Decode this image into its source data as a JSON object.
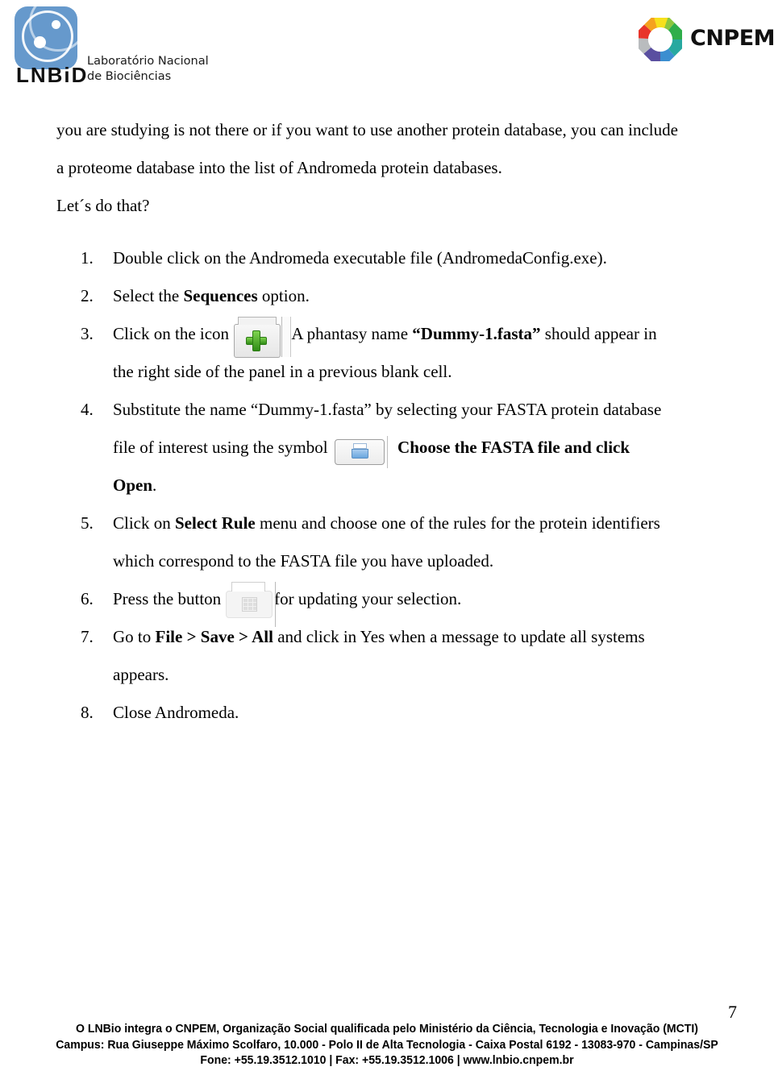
{
  "header": {
    "lnbio": {
      "wordmark": "LNBiD",
      "tagline_line1": "Laboratório Nacional",
      "tagline_line2": "de Biociências",
      "logo_color": "#6699cc"
    },
    "cnpem": {
      "wordmark": "CNPEM",
      "ring_colors": [
        "#e8352b",
        "#f5a21f",
        "#f7e01c",
        "#8cc63e",
        "#2fae4a",
        "#3aa9e0",
        "#3b5ba8",
        "#7e4fa0"
      ]
    }
  },
  "content": {
    "paragraph1_part1": "you are studying is not there or if you want to use another protein database, you can include",
    "paragraph1_part2": "a proteome database into the list of Andromeda protein databases.",
    "paragraph2": "Let´s do that?"
  },
  "steps": [
    {
      "number": "1.",
      "text": "Double click on the Andromeda executable file (AndromedaConfig.exe)."
    },
    {
      "number": "2.",
      "text_before": "Select the ",
      "bold": "Sequences",
      "text_after": " option."
    },
    {
      "number": "3.",
      "text_before": "Click on the icon",
      "icon": "green-plus-button-icon",
      "text_mid": ". A phantasy name ",
      "bold": "“Dummy-1.fasta”",
      "text_after": " should appear in",
      "text_line2": "the right side of the panel in a previous blank cell."
    },
    {
      "number": "4.",
      "text_line1": "Substitute the name “Dummy-1.fasta” by selecting your FASTA protein database",
      "text_line2_before": "file of interest using the symbol",
      "icon": "open-folder-button-icon",
      "bold_after": ". Choose the FASTA file and click",
      "bold_line3": "Open",
      "text_end": "."
    },
    {
      "number": "5.",
      "text_before": "Click on ",
      "bold": "Select Rule",
      "text_after": " menu and choose one of the rules for the protein identifiers",
      "text_line2": "which correspond to the FASTA file you have uploaded."
    },
    {
      "number": "6.",
      "text_before": "Press the button",
      "icon": "update-grid-button-icon",
      "text_after": "for updating your selection."
    },
    {
      "number": "7.",
      "text_before": "Go to ",
      "bold": "File > Save > All",
      "text_after": " and click in Yes when a message to update all systems",
      "text_line2": "appears."
    },
    {
      "number": "8.",
      "text": "Close Andromeda."
    }
  ],
  "footer": {
    "page_number": "7",
    "line1": "O LNBio integra o CNPEM, Organização Social qualificada pelo Ministério da Ciência, Tecnologia e Inovação (MCTI)",
    "line2": "Campus: Rua Giuseppe Máximo Scolfaro, 10.000 - Polo II de Alta Tecnologia - Caixa Postal 6192 - 13083-970 - Campinas/SP",
    "line3": "Fone: +55.19.3512.1010 | Fax: +55.19.3512.1006 | www.lnbio.cnpem.br"
  }
}
